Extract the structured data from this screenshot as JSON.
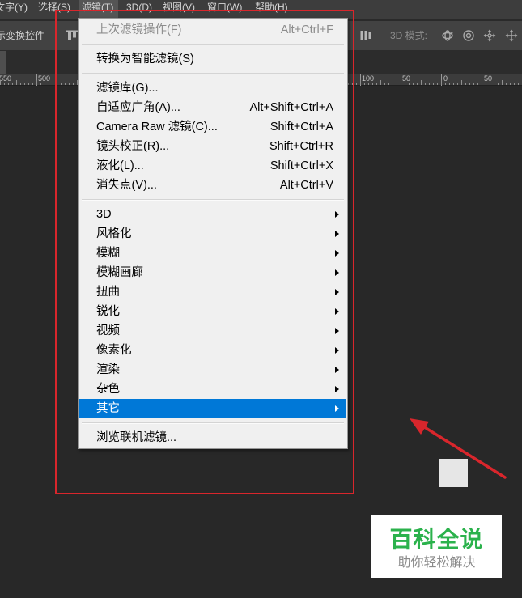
{
  "menubar": {
    "items": [
      "文字(Y)",
      "选择(S)",
      "滤镜(T)",
      "3D(D)",
      "视图(V)",
      "窗口(W)",
      "帮助(H)"
    ],
    "active_index": 2
  },
  "options_bar": {
    "transform_controls_label": "示变换控件",
    "mode_3d_label": "3D 模式:",
    "icons": [
      "align-icon",
      "distribute-icon"
    ],
    "mode_3d_icons": [
      "rotate-3d-icon",
      "roll-3d-icon",
      "drag-3d-icon",
      "slide-3d-icon"
    ]
  },
  "ruler": {
    "labels": [
      "550",
      "500",
      "100",
      "50",
      "0",
      "50"
    ]
  },
  "filter_menu": {
    "items": [
      {
        "label": "上次滤镜操作(F)",
        "shortcut": "Alt+Ctrl+F",
        "disabled": true
      },
      {
        "label": "转换为智能滤镜(S)"
      },
      {
        "label": "滤镜库(G)..."
      },
      {
        "label": "自适应广角(A)...",
        "shortcut": "Alt+Shift+Ctrl+A"
      },
      {
        "label": "Camera Raw 滤镜(C)...",
        "shortcut": "Shift+Ctrl+A"
      },
      {
        "label": "镜头校正(R)...",
        "shortcut": "Shift+Ctrl+R"
      },
      {
        "label": "液化(L)...",
        "shortcut": "Shift+Ctrl+X"
      },
      {
        "label": "消失点(V)...",
        "shortcut": "Alt+Ctrl+V"
      },
      {
        "label": "3D",
        "submenu": true
      },
      {
        "label": "风格化",
        "submenu": true
      },
      {
        "label": "模糊",
        "submenu": true
      },
      {
        "label": "模糊画廊",
        "submenu": true
      },
      {
        "label": "扭曲",
        "submenu": true
      },
      {
        "label": "锐化",
        "submenu": true
      },
      {
        "label": "视频",
        "submenu": true
      },
      {
        "label": "像素化",
        "submenu": true
      },
      {
        "label": "渲染",
        "submenu": true
      },
      {
        "label": "杂色",
        "submenu": true
      },
      {
        "label": "其它",
        "submenu": true,
        "highlighted": true
      },
      {
        "label": "浏览联机滤镜..."
      }
    ],
    "submenu_icon": "chevron-right-icon"
  },
  "watermark": {
    "title": "百科全说",
    "subtitle": "助你轻松解决"
  },
  "colors": {
    "menu_highlight": "#0078d7",
    "annotation": "#d9262c",
    "watermark_title": "#2bb24c",
    "watermark_subtitle": "#8a8a8a"
  }
}
